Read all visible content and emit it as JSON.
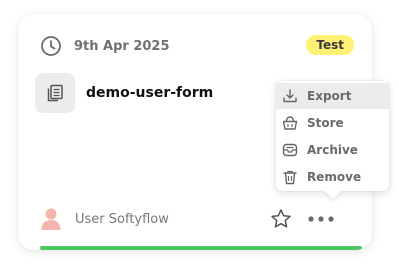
{
  "card": {
    "date": "9th Apr 2025",
    "badge": "Test",
    "form_name": "demo-user-form",
    "owner": "User Softyflow",
    "status_color": "#4cc95e",
    "badge_color": "#fff176"
  },
  "icons": {
    "date": "clock-icon",
    "form": "form-document-icon",
    "owner": "user-avatar-icon",
    "favorite": "star-icon",
    "more": "more-horizontal-icon"
  },
  "menu": {
    "items": [
      {
        "label": "Export",
        "icon": "export-icon",
        "active": true
      },
      {
        "label": "Store",
        "icon": "store-basket-icon",
        "active": false
      },
      {
        "label": "Archive",
        "icon": "archive-icon",
        "active": false
      },
      {
        "label": "Remove",
        "icon": "trash-icon",
        "active": false
      }
    ]
  }
}
